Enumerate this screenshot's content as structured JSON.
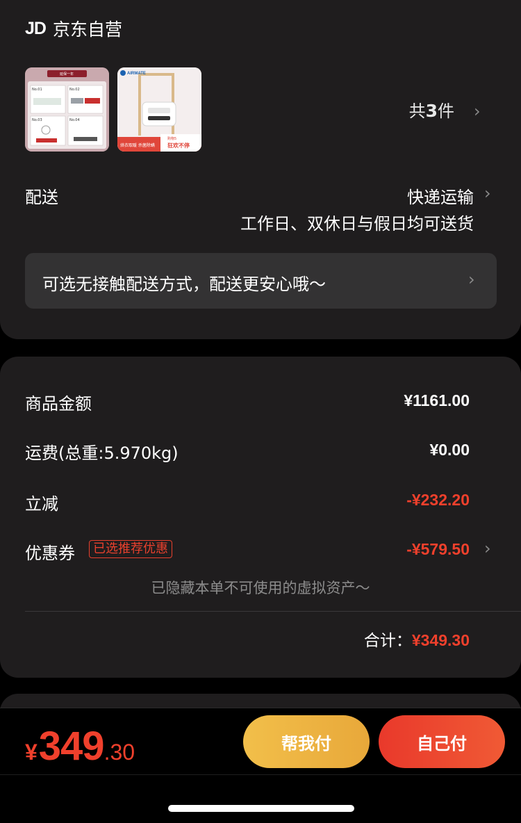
{
  "store": {
    "logo": "JD",
    "name": "京东自营"
  },
  "items": {
    "count_prefix": "共",
    "count": "3",
    "count_suffix": "件",
    "thumb1": {
      "tag": "「 延保一年 」",
      "sub": "品牌服务·放心保障",
      "no1": "No.01",
      "no2": "No.02",
      "no3": "No.03",
      "no4": "No.04"
    },
    "thumb2": {
      "brand": "AIRMATE",
      "promo": "烘衣取暖 杀菌除螨",
      "badge": "狂欢不停",
      "corner": "购物5"
    }
  },
  "delivery": {
    "label": "配送",
    "method": "快递运输",
    "schedule": "工作日、双休日与假日均可送货",
    "contactless": "可选无接触配送方式，配送更安心哦～"
  },
  "price": {
    "goods_label": "商品金额",
    "goods_value": "¥1161.00",
    "shipping_label": "运费(总重:5.970kg)",
    "shipping_value": "¥0.00",
    "discount_label": "立减",
    "discount_value": "-¥232.20",
    "coupon_label": "优惠券",
    "coupon_badge": "已选推荐优惠",
    "coupon_value": "-¥579.50",
    "hidden_note": "已隐藏本单不可使用的虚拟资产～",
    "total_label": "合计：",
    "total_value": "¥349.30"
  },
  "pay_bar": {
    "currency": "¥",
    "price_int": "349",
    "price_dec": ".30",
    "help_pay": "帮我付",
    "self_pay": "自己付"
  },
  "colors": {
    "accent_red": "#f0402c",
    "help_button": "#f2bf4a",
    "self_button": "#e9392b",
    "card_bg": "#1f1d1e",
    "page_bg": "#000000"
  }
}
